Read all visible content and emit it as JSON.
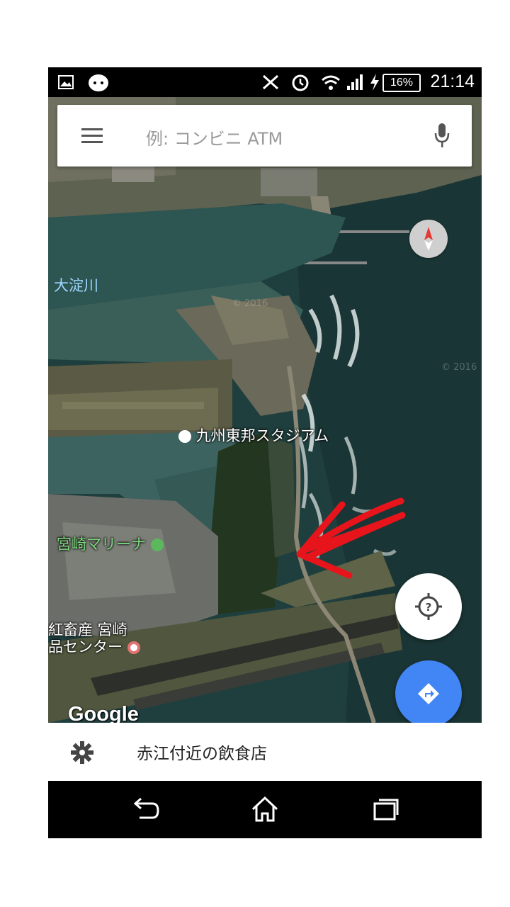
{
  "status_bar": {
    "time": "21:14",
    "battery": "16%",
    "icons": [
      "image-icon",
      "notification-app-icon",
      "nfc-icon",
      "alarm-icon",
      "wifi-icon",
      "signal-icon",
      "charging-icon",
      "battery-icon"
    ]
  },
  "search": {
    "placeholder": "例: コンビニ ATM",
    "menu_icon": "hamburger-menu-icon",
    "mic_icon": "microphone-icon"
  },
  "map": {
    "labels": {
      "river": "大淀川",
      "stadium": "九州東邦スタジアム",
      "marina": "宮崎マリーナ",
      "center_line1": "紅畜産 宮崎",
      "center_line2": "品センター"
    },
    "watermark": "© 2016",
    "attribution": "Google",
    "annotation": "red-hand-drawn-arrow"
  },
  "buttons": {
    "compass": "compass-icon",
    "my_location": "location-help-icon",
    "directions": "directions-icon"
  },
  "bottom_card": {
    "icon": "gear-icon",
    "title": "赤江付近の飲食店"
  },
  "nav_bar": [
    "back-icon",
    "home-icon",
    "recents-icon"
  ],
  "colors": {
    "directions_blue": "#4285f4",
    "river_label": "#9fd7ff",
    "marina_label": "#7ed77e",
    "annotation_red": "#e8141b"
  }
}
